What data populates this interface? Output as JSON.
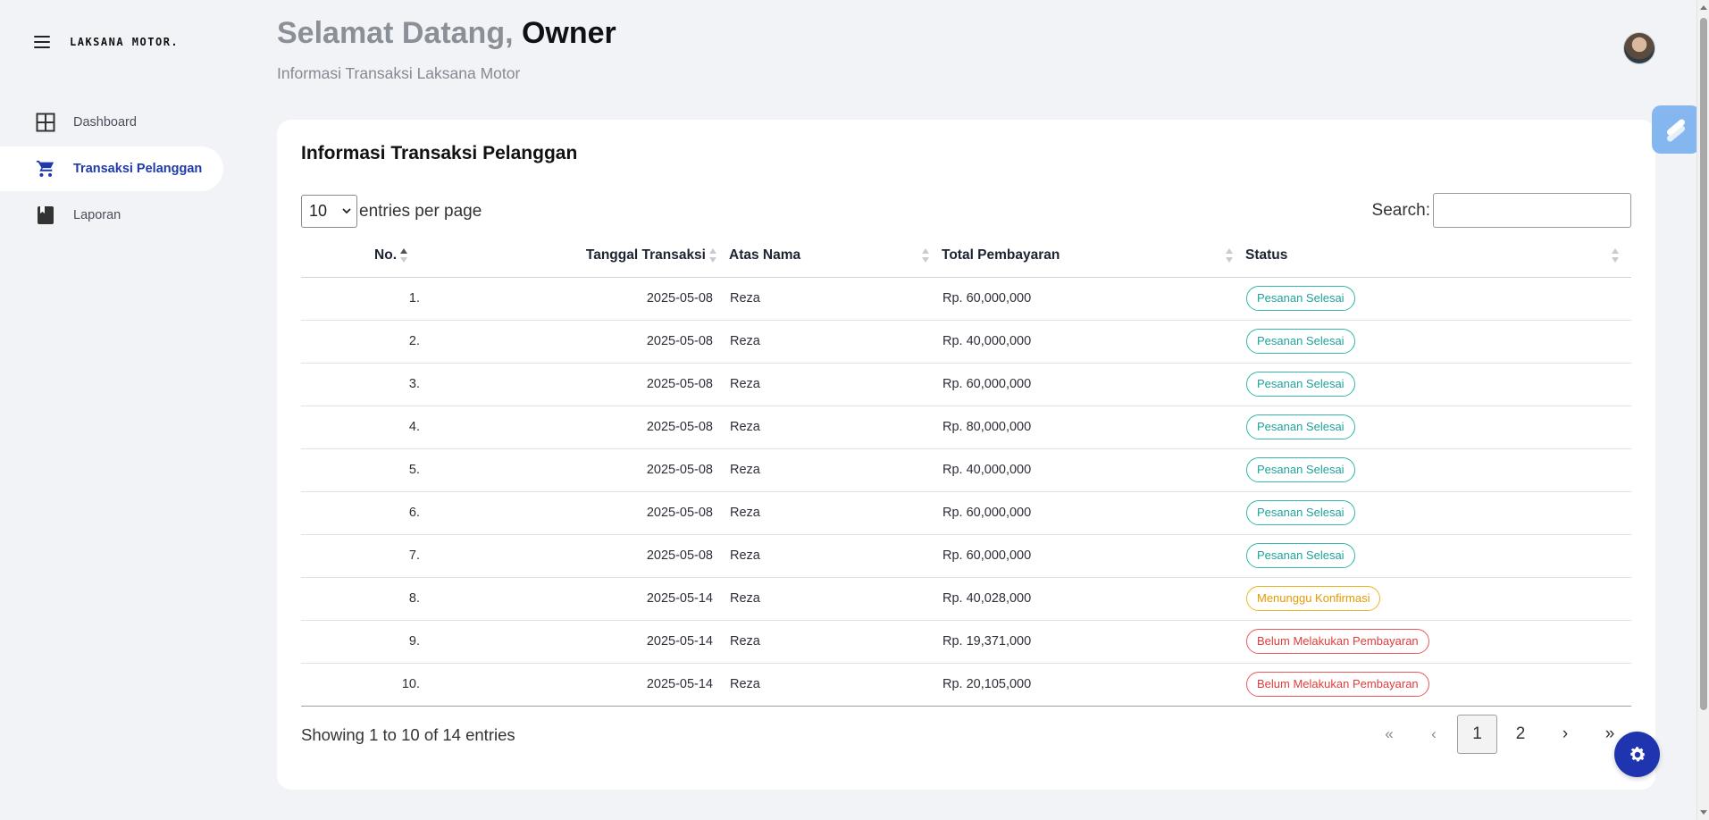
{
  "brand": "LAKSANA MOTOR.",
  "nav": [
    {
      "label": "Dashboard",
      "icon": "grid-icon",
      "active": false
    },
    {
      "label": "Transaksi Pelanggan",
      "icon": "cart-icon",
      "active": true
    },
    {
      "label": "Laporan",
      "icon": "book-icon",
      "active": false
    }
  ],
  "header": {
    "greeting_prefix": "Selamat Datang,",
    "greeting_name": "Owner",
    "subtitle": "Informasi Transaksi Laksana Motor"
  },
  "card": {
    "title": "Informasi Transaksi Pelanggan",
    "entries_value": "10",
    "entries_label": "entries per page",
    "search_label": "Search:",
    "search_value": "",
    "columns": [
      "No.",
      "Tanggal Transaksi",
      "Atas Nama",
      "Total Pembayaran",
      "Status"
    ],
    "rows": [
      {
        "no": "1.",
        "date": "2025-05-08",
        "name": "Reza",
        "total": "Rp. 60,000,000",
        "status": "Pesanan Selesai",
        "status_type": "ok"
      },
      {
        "no": "2.",
        "date": "2025-05-08",
        "name": "Reza",
        "total": "Rp. 40,000,000",
        "status": "Pesanan Selesai",
        "status_type": "ok"
      },
      {
        "no": "3.",
        "date": "2025-05-08",
        "name": "Reza",
        "total": "Rp. 60,000,000",
        "status": "Pesanan Selesai",
        "status_type": "ok"
      },
      {
        "no": "4.",
        "date": "2025-05-08",
        "name": "Reza",
        "total": "Rp. 80,000,000",
        "status": "Pesanan Selesai",
        "status_type": "ok"
      },
      {
        "no": "5.",
        "date": "2025-05-08",
        "name": "Reza",
        "total": "Rp. 40,000,000",
        "status": "Pesanan Selesai",
        "status_type": "ok"
      },
      {
        "no": "6.",
        "date": "2025-05-08",
        "name": "Reza",
        "total": "Rp. 60,000,000",
        "status": "Pesanan Selesai",
        "status_type": "ok"
      },
      {
        "no": "7.",
        "date": "2025-05-08",
        "name": "Reza",
        "total": "Rp. 60,000,000",
        "status": "Pesanan Selesai",
        "status_type": "ok"
      },
      {
        "no": "8.",
        "date": "2025-05-14",
        "name": "Reza",
        "total": "Rp. 40,028,000",
        "status": "Menunggu Konfirmasi",
        "status_type": "wait"
      },
      {
        "no": "9.",
        "date": "2025-05-14",
        "name": "Reza",
        "total": "Rp. 19,371,000",
        "status": "Belum Melakukan Pembayaran",
        "status_type": "unpaid"
      },
      {
        "no": "10.",
        "date": "2025-05-14",
        "name": "Reza",
        "total": "Rp. 20,105,000",
        "status": "Belum Melakukan Pembayaran",
        "status_type": "unpaid"
      }
    ],
    "info": "Showing 1 to 10 of 14 entries",
    "pager": {
      "first": "«",
      "prev": "‹",
      "pages": [
        "1",
        "2"
      ],
      "current": "1",
      "next": "›",
      "last": "»"
    }
  },
  "colors": {
    "accent": "#1f3aa8",
    "ok": "#1ea39a",
    "wait": "#e49a00",
    "unpaid": "#e23b3b",
    "fab": "#1f35b0"
  }
}
